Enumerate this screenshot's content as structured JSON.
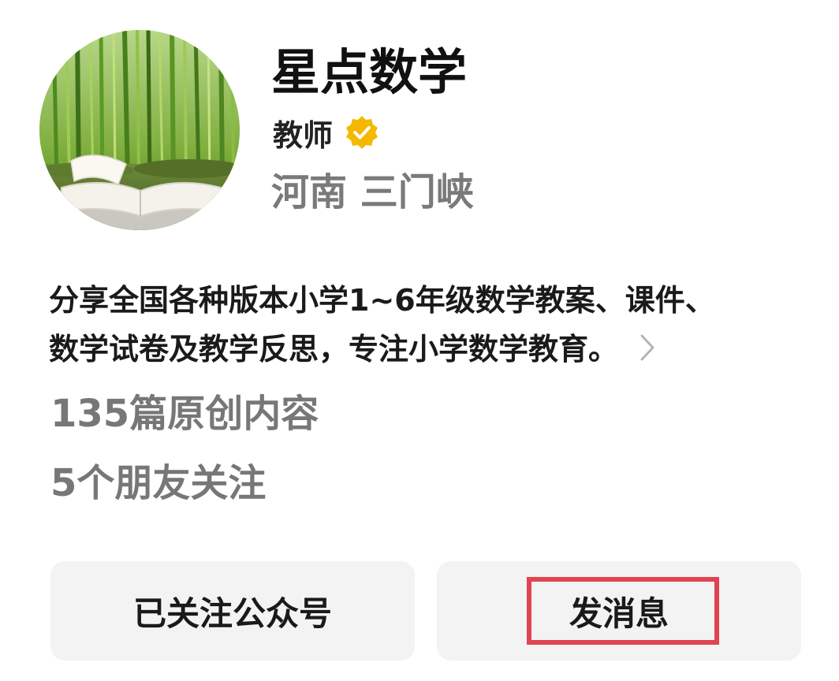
{
  "profile": {
    "name": "星点数学",
    "role": "教师",
    "verified_icon": "verified-badge-icon",
    "location": "河南 三门峡",
    "bio_lines": [
      "分享全国各种版本小学1~6年级数学教案、课件、",
      "数学试卷及教学反思，专注小学数学教育。"
    ],
    "articles": "135篇原创内容",
    "friends": "5个朋友关注"
  },
  "actions": {
    "follow_label": "已关注公众号",
    "message_label": "发消息"
  },
  "colors": {
    "badge": "#f5b800",
    "highlight": "#e04451",
    "button_bg": "#f3f3f3",
    "secondary_text": "#7a7a7a"
  }
}
